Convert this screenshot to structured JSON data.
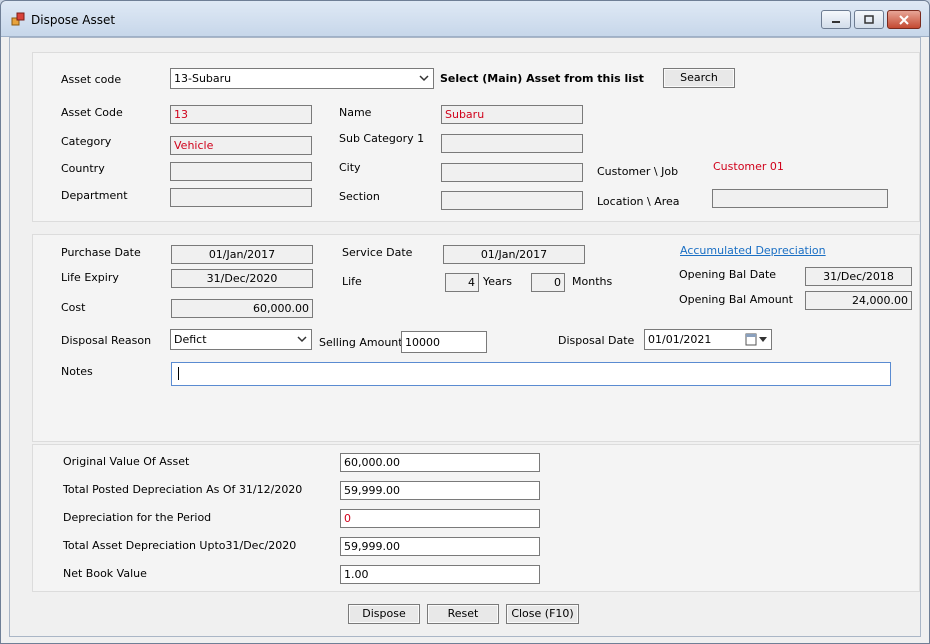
{
  "window": {
    "title": "Dispose Asset"
  },
  "top": {
    "asset_code_label": "Asset code",
    "asset_select_value": "13-Subaru",
    "select_hint": "Select (Main) Asset from this list",
    "search_button": "Search",
    "asset_code2_label": "Asset Code",
    "asset_code2_value": "13",
    "name_label": "Name",
    "name_value": "Subaru",
    "category_label": "Category",
    "category_value": "Vehicle",
    "subcat_label": "Sub Category 1",
    "subcat_value": "",
    "country_label": "Country",
    "country_value": "",
    "city_label": "City",
    "city_value": "",
    "customer_job_label": "Customer \\ Job",
    "customer_value": "Customer 01",
    "department_label": "Department",
    "department_value": "",
    "section_label": "Section",
    "section_value": "",
    "location_label": "Location \\ Area",
    "location_value": ""
  },
  "middle": {
    "purchase_date_label": "Purchase Date",
    "purchase_date_value": "01/Jan/2017",
    "service_date_label": "Service Date",
    "service_date_value": "01/Jan/2017",
    "accum_dep_link": "Accumulated Depreciation",
    "life_expiry_label": "Life Expiry",
    "life_expiry_value": "31/Dec/2020",
    "life_label": "Life",
    "life_years": "4",
    "years_label": "Years",
    "life_months": "0",
    "months_label": "Months",
    "opening_bal_date_label": "Opening Bal Date",
    "opening_bal_date_value": "31/Dec/2018",
    "opening_bal_amount_label": "Opening Bal Amount",
    "opening_bal_amount_value": "24,000.00",
    "cost_label": "Cost",
    "cost_value": "60,000.00",
    "disposal_reason_label": "Disposal Reason",
    "disposal_reason_value": "Defict",
    "selling_amount_label": "Selling Amount",
    "selling_amount_value": "10000",
    "disposal_date_label": "Disposal Date",
    "disposal_date_value": "01/01/2021",
    "notes_label": "Notes",
    "notes_value": ""
  },
  "bottom": {
    "orig_value_label": "Original Value Of Asset",
    "orig_value": "60,000.00",
    "total_posted_label": "Total Posted Depreciation As Of 31/12/2020",
    "total_posted_value": "59,999.00",
    "dep_period_label": "Depreciation for the Period",
    "dep_period_value": "0",
    "total_asset_dep_label": "Total Asset Depreciation Upto31/Dec/2020",
    "total_asset_dep_value": "59,999.00",
    "net_book_label": "Net Book Value",
    "net_book_value": "1.00"
  },
  "actions": {
    "dispose": "Dispose",
    "reset": "Reset",
    "close": "Close (F10)"
  },
  "colors": {
    "accent_red": "#d0021b",
    "link_blue": "#1a6fc4"
  },
  "icons": [
    "app-icon",
    "minimize-icon",
    "maximize-icon",
    "close-icon",
    "dropdown-arrow-icon",
    "calendar-icon"
  ]
}
